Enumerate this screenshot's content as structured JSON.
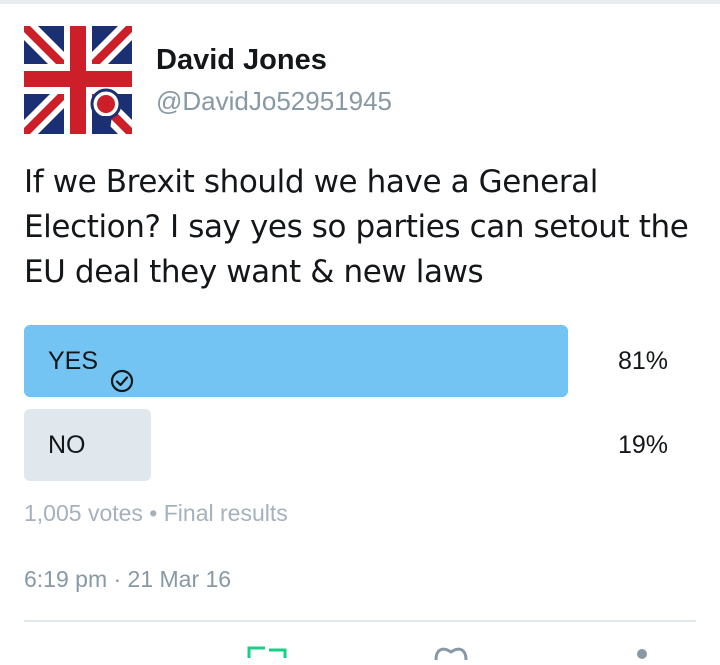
{
  "author": {
    "name": "David Jones",
    "handle": "@DavidJo52951945"
  },
  "tweet": {
    "text": "If we Brexit should we have a General Election? I say yes so parties can setout the EU deal they want & new laws"
  },
  "poll": {
    "options": [
      {
        "label": "YES",
        "percent_text": "81%",
        "percent": 81,
        "selected": true
      },
      {
        "label": "NO",
        "percent_text": "19%",
        "percent": 19,
        "selected": false
      }
    ],
    "summary": "1,005 votes • Final results"
  },
  "timestamp": "6:19 pm · 21 Mar 16",
  "colors": {
    "winner_bar": "#74c4f3",
    "loser_bar": "#e1e8ed",
    "muted_text": "#8899a6",
    "action_green": "#19cf86"
  },
  "icons": {
    "check": "check-circle-icon",
    "retweet": "retweet-icon",
    "like": "heart-icon",
    "more": "more-icon"
  }
}
